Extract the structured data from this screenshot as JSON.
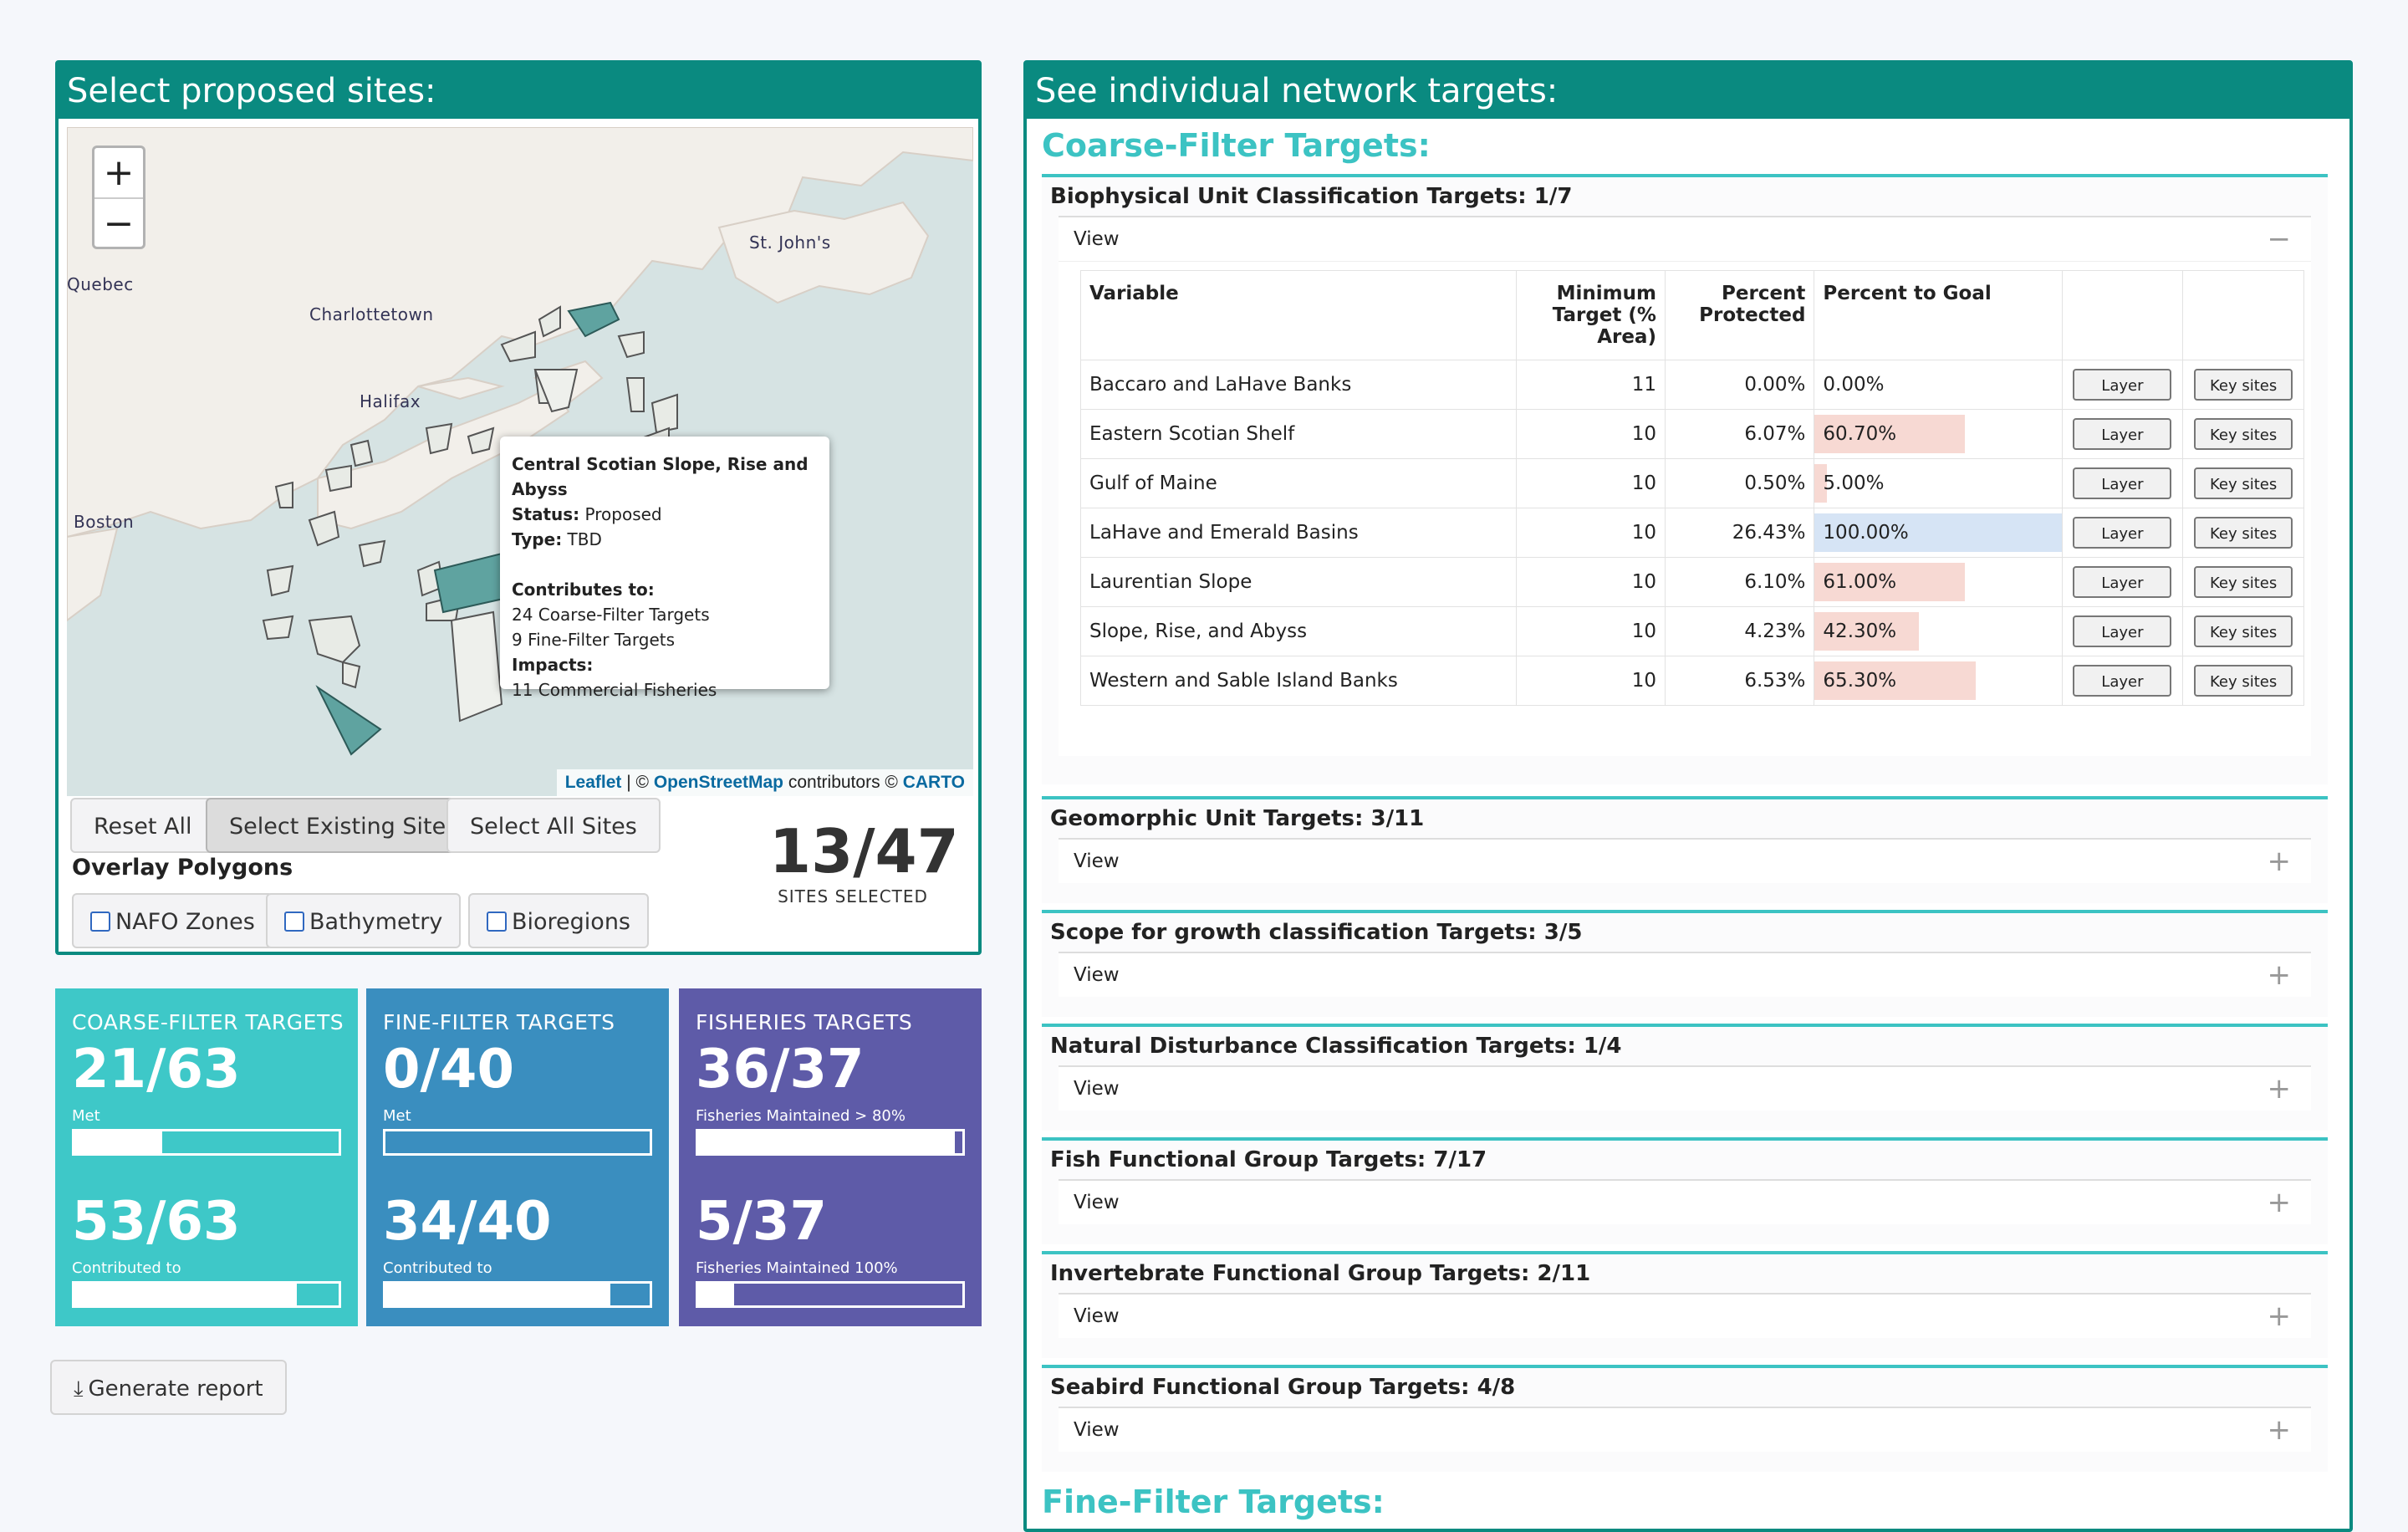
{
  "left_card": {
    "title": "Select proposed sites:",
    "zoom_in": "+",
    "zoom_out": "−",
    "map_labels": {
      "quebec": "Quebec",
      "charlottetown": "Charlottetown",
      "halifax": "Halifax",
      "boston": "Boston",
      "stjohns": "St. John's"
    },
    "attribution": {
      "leaflet": "Leaflet",
      "sep": " | © ",
      "osm": "OpenStreetMap",
      "contrib": " contributors © ",
      "carto": "CARTO"
    },
    "popup": {
      "title": "Central Scotian Slope, Rise and Abyss",
      "status_label": "Status:",
      "status_value": "Proposed",
      "type_label": "Type:",
      "type_value": "TBD",
      "contributes_label": "Contributes to:",
      "coarse": "24 Coarse-Filter Targets",
      "fine": "9 Fine-Filter Targets",
      "impacts_label": "Impacts:",
      "fisheries": "11 Commercial Fisheries"
    },
    "buttons": {
      "reset": "Reset All",
      "existing": "Select Existing Sites",
      "all": "Select All Sites"
    },
    "overlay_title": "Overlay Polygons",
    "overlays": {
      "nafo": "NAFO Zones",
      "bathymetry": "Bathymetry",
      "bioregions": "Bioregions"
    },
    "sites_selected": {
      "value": "13/47",
      "label": "SITES SELECTED"
    }
  },
  "stats": {
    "coarse": {
      "title": "COARSE-FILTER TARGETS",
      "color": "#3ec8c8",
      "met": "21/63",
      "met_label": "Met",
      "met_fraction": 0.333,
      "contrib": "53/63",
      "contrib_label": "Contributed to",
      "contrib_fraction": 0.841
    },
    "fine": {
      "title": "FINE-FILTER TARGETS",
      "color": "#3a8ebf",
      "met": "0/40",
      "met_label": "Met",
      "met_fraction": 0.0,
      "contrib": "34/40",
      "contrib_label": "Contributed to",
      "contrib_fraction": 0.85
    },
    "fisheries": {
      "title": "FISHERIES TARGETS",
      "color": "#5e5ba8",
      "met": "36/37",
      "met_label": "Fisheries Maintained > 80%",
      "met_fraction": 0.973,
      "contrib": "5/37",
      "contrib_label": "Fisheries Maintained 100%",
      "contrib_fraction": 0.135
    }
  },
  "generate_report": "Generate report",
  "right_card": {
    "title": "See individual network targets:",
    "section": "Coarse-Filter Targets:",
    "next_section": "Fine-Filter Targets:",
    "view_label": "View",
    "table": {
      "headers": [
        "Variable",
        "Minimum Target (% Area)",
        "Percent Protected",
        "Percent to Goal",
        "",
        ""
      ],
      "layer_btn": "Layer",
      "key_btn": "Key sites",
      "rows": [
        {
          "variable": "Baccaro and LaHave Banks",
          "min": "11",
          "protected": "0.00%",
          "goal": "0.00%",
          "goal_frac": 0.0,
          "met": false
        },
        {
          "variable": "Eastern Scotian Shelf",
          "min": "10",
          "protected": "6.07%",
          "goal": "60.70%",
          "goal_frac": 0.607,
          "met": false
        },
        {
          "variable": "Gulf of Maine",
          "min": "10",
          "protected": "0.50%",
          "goal": "5.00%",
          "goal_frac": 0.05,
          "met": false
        },
        {
          "variable": "LaHave and Emerald Basins",
          "min": "10",
          "protected": "26.43%",
          "goal": "100.00%",
          "goal_frac": 1.0,
          "met": true
        },
        {
          "variable": "Laurentian Slope",
          "min": "10",
          "protected": "6.10%",
          "goal": "61.00%",
          "goal_frac": 0.61,
          "met": false
        },
        {
          "variable": "Slope, Rise, and Abyss",
          "min": "10",
          "protected": "4.23%",
          "goal": "42.30%",
          "goal_frac": 0.423,
          "met": false
        },
        {
          "variable": "Western and Sable Island Banks",
          "min": "10",
          "protected": "6.53%",
          "goal": "65.30%",
          "goal_frac": 0.653,
          "met": false
        }
      ]
    },
    "accordions": [
      {
        "title": "Biophysical Unit Classification Targets: 1/7",
        "toggle": "−"
      },
      {
        "title": "Geomorphic Unit Targets: 3/11",
        "toggle": "+"
      },
      {
        "title": "Scope for growth classification Targets: 3/5",
        "toggle": "+"
      },
      {
        "title": "Natural Disturbance Classification Targets: 1/4",
        "toggle": "+"
      },
      {
        "title": "Fish Functional Group Targets: 7/17",
        "toggle": "+"
      },
      {
        "title": "Invertebrate Functional Group Targets: 2/11",
        "toggle": "+"
      },
      {
        "title": "Seabird Functional Group Targets: 4/8",
        "toggle": "+"
      }
    ]
  }
}
